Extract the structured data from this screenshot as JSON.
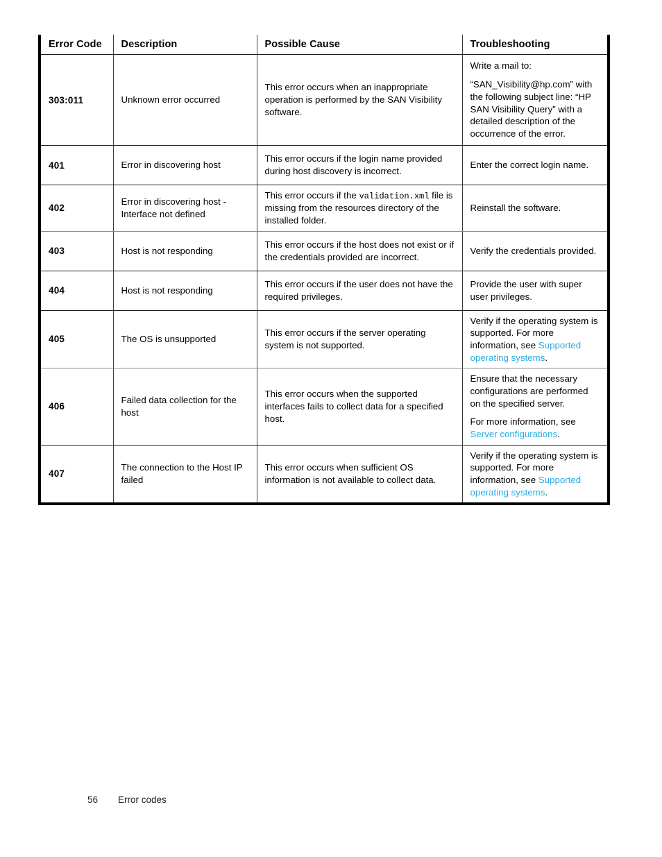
{
  "table": {
    "columns": [
      "Error Code",
      "Description",
      "Possible Cause",
      "Troubleshooting"
    ],
    "rows": [
      {
        "code": "303:011",
        "description": "Unknown error occurred",
        "cause": "This error occurs when an inappropriate operation is performed by the SAN Visibility software.",
        "troubleshooting_1": "Write a mail to:",
        "troubleshooting_2": "“SAN_Visibility@hp.com” with the following subject line: “HP SAN Visibility Query” with a detailed description of the occurrence of the error."
      },
      {
        "code": "401",
        "description": "Error in discovering host",
        "cause": "This error occurs if the login name provided during host discovery is incorrect.",
        "troubleshooting_1": "Enter the correct login name."
      },
      {
        "code": "402",
        "description": "Error in discovering host - Interface not defined",
        "cause_pre": "This error occurs if the ",
        "cause_mono": "validation.xml",
        "cause_post": " file is missing from the resources directory of the installed folder.",
        "troubleshooting_1": "Reinstall the software."
      },
      {
        "code": "403",
        "description": "Host is not responding",
        "cause": "This error occurs if the host does not exist or if the credentials provided are incorrect.",
        "troubleshooting_1": "Verify the credentials provided."
      },
      {
        "code": "404",
        "description": "Host is not responding",
        "cause": "This error occurs if the user does not have the required privileges.",
        "troubleshooting_1": "Provide the user with super user privileges."
      },
      {
        "code": "405",
        "description": "The OS is unsupported",
        "cause": "This error occurs if the server operating system is not supported.",
        "troubleshooting_pre": "Verify if the operating system is supported. For more information, see ",
        "troubleshooting_link": "Supported operating systems",
        "troubleshooting_post": "."
      },
      {
        "code": "406",
        "description": "Failed data collection for the host",
        "cause": "This error occurs when the supported interfaces fails to collect data for a specified host.",
        "troubleshooting_1": "Ensure that the necessary configurations are performed on the specified server.",
        "troubleshooting_pre": "For more information, see ",
        "troubleshooting_link": "Server configurations",
        "troubleshooting_post": "."
      },
      {
        "code": "407",
        "description": "The connection to the Host IP failed",
        "cause": "This error occurs when sufficient OS information is not available to collect data.",
        "troubleshooting_pre": "Verify if the operating system is supported. For more information, see ",
        "troubleshooting_link": "Supported operating systems",
        "troubleshooting_post": "."
      }
    ]
  },
  "footer": {
    "page_number": "56",
    "section": "Error codes"
  },
  "colors": {
    "link": "#29abe2",
    "text": "#000000",
    "rule": "#1a1a1a"
  }
}
